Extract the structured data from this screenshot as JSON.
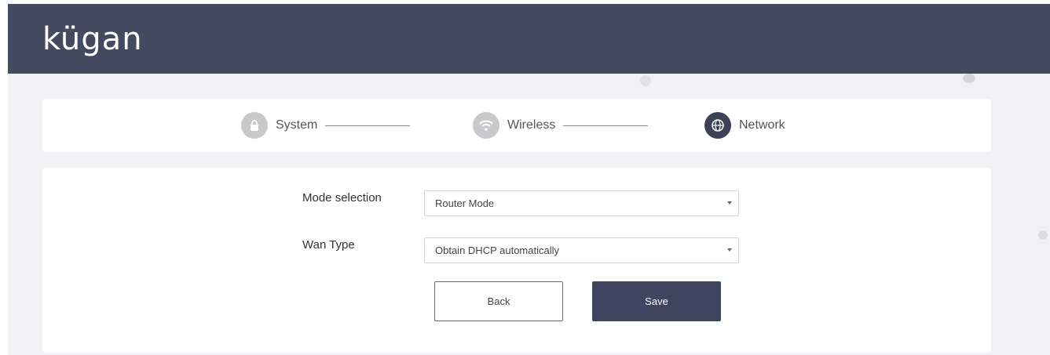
{
  "brand": {
    "logo": "kügan"
  },
  "colors": {
    "header": "#444a60",
    "accent": "#3f4560",
    "inactive_step": "#c9c9cc"
  },
  "steps": [
    {
      "label": "System",
      "icon": "lock-icon",
      "state": "complete"
    },
    {
      "label": "Wireless",
      "icon": "wifi-icon",
      "state": "complete"
    },
    {
      "label": "Network",
      "icon": "globe-icon",
      "state": "active"
    }
  ],
  "form": {
    "mode": {
      "label": "Mode selection",
      "value": "Router Mode"
    },
    "wan": {
      "label": "Wan Type",
      "value": "Obtain DHCP automatically"
    },
    "back_label": "Back",
    "save_label": "Save"
  }
}
